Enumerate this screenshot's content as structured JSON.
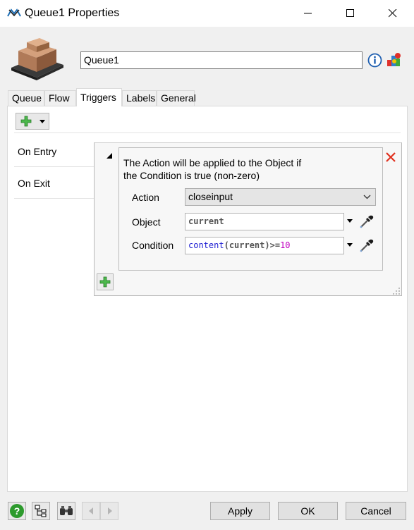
{
  "window": {
    "title": "Queue1  Properties"
  },
  "header": {
    "object_name": "Queue1"
  },
  "tabs": [
    {
      "label": "Queue"
    },
    {
      "label": "Flow"
    },
    {
      "label": "Triggers"
    },
    {
      "label": "Labels"
    },
    {
      "label": "General"
    }
  ],
  "triggers": {
    "items": [
      {
        "label": "On Entry"
      },
      {
        "label": "On Exit"
      }
    ],
    "description_line1": "The Action will be applied to the Object if",
    "description_line2": "the Condition is true (non-zero)",
    "action_label": "Action",
    "action_value": "closeinput",
    "object_label": "Object",
    "object_value": "current",
    "condition_label": "Condition",
    "condition_tokens": {
      "fn": "content",
      "open": "(",
      "arg": "current",
      "close": ")>=",
      "num": "10"
    }
  },
  "buttons": {
    "apply": "Apply",
    "ok": "OK",
    "cancel": "Cancel"
  },
  "colors": {
    "accent_green": "#3ca83c",
    "close_red": "#e0301e",
    "keyword_blue": "#1e1ed2",
    "number_magenta": "#c000c0"
  }
}
